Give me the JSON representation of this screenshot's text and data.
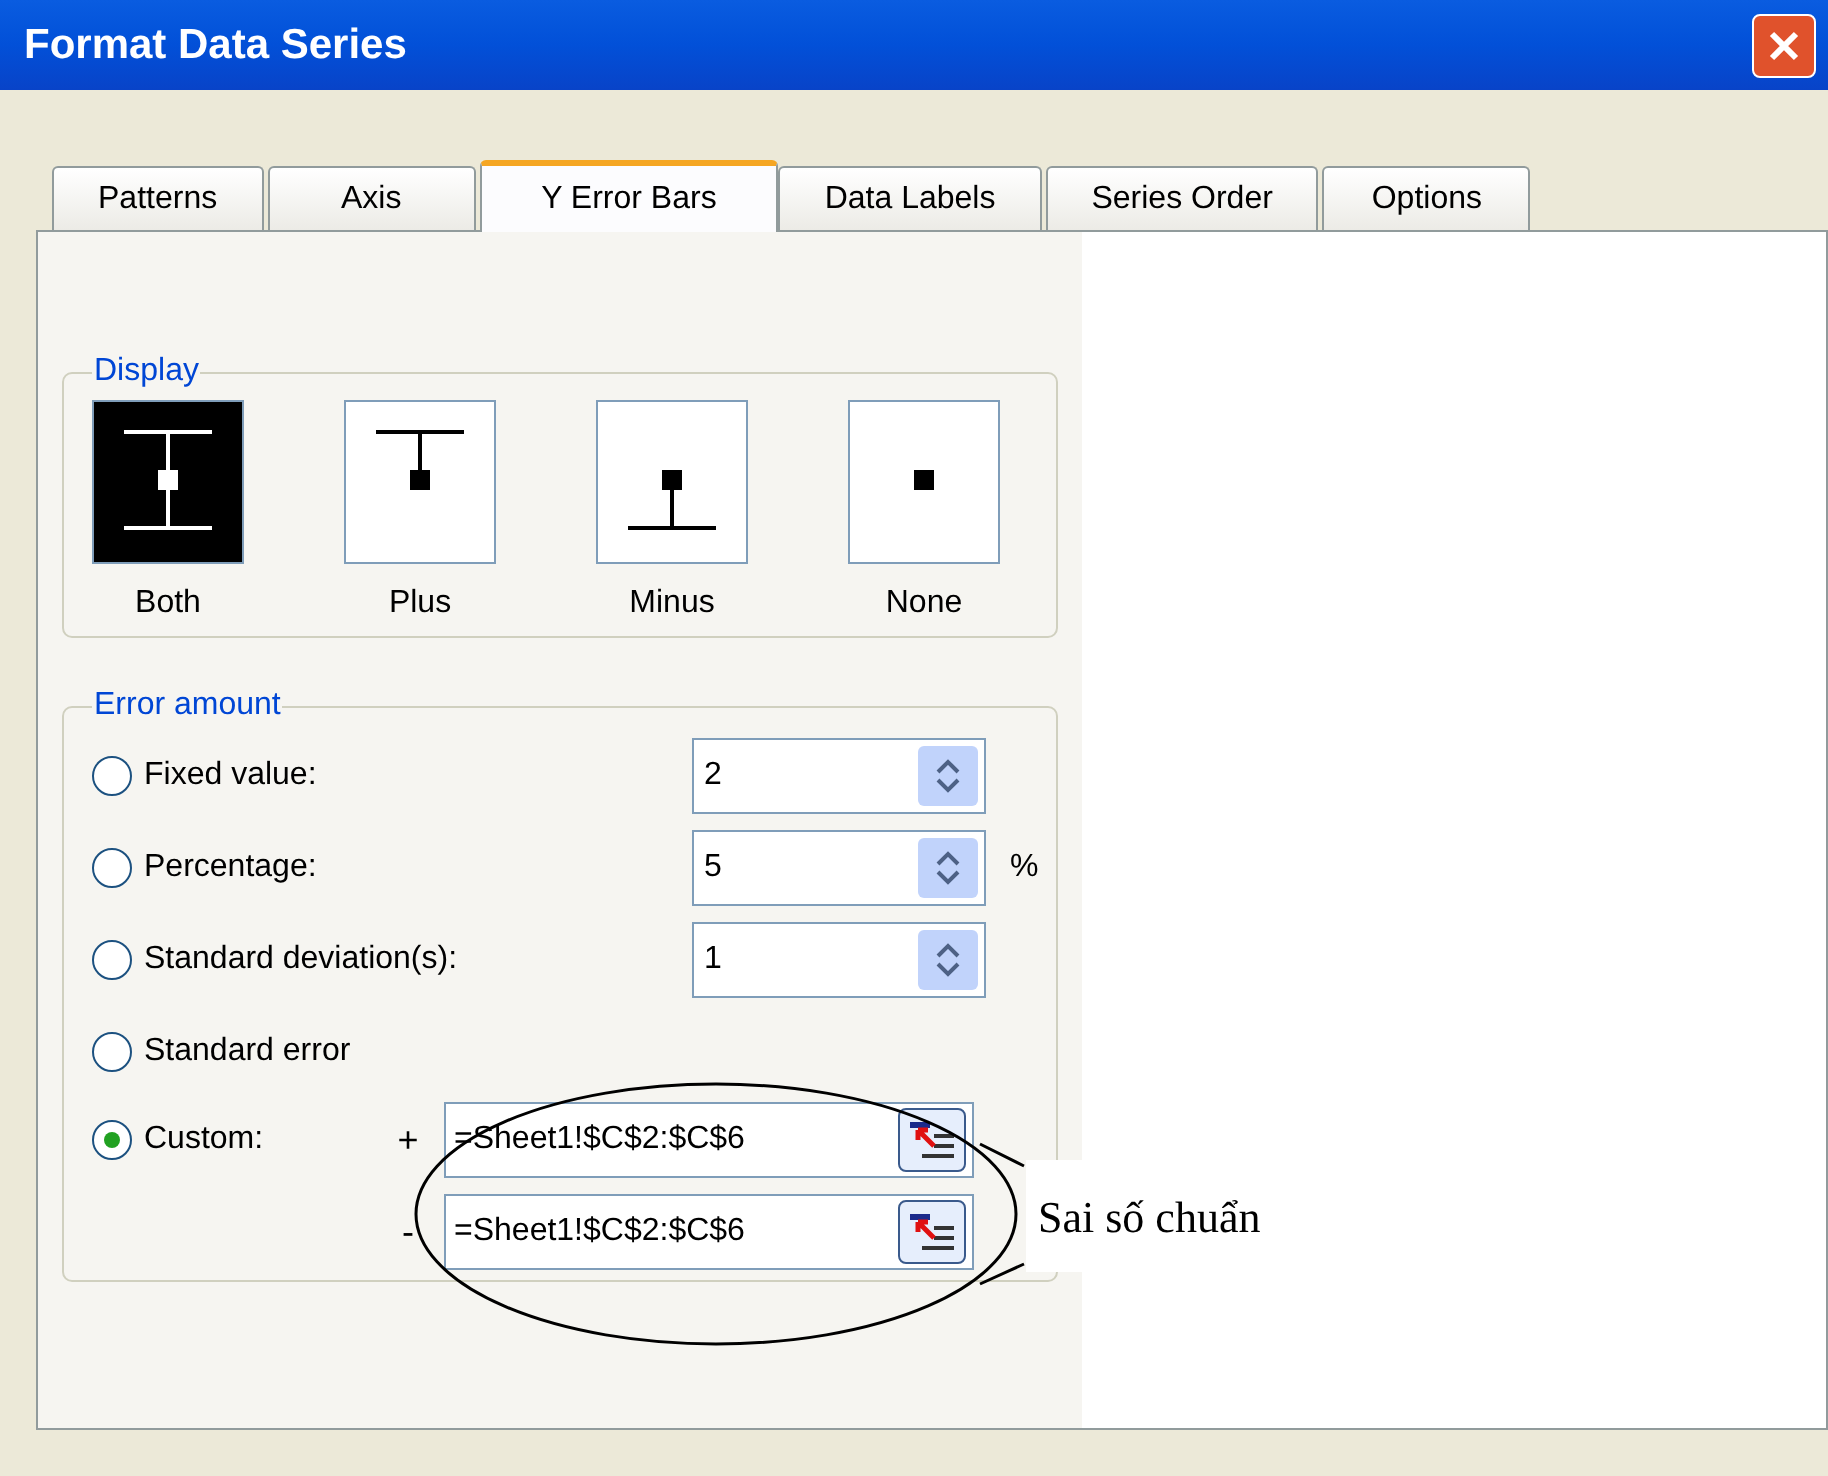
{
  "window": {
    "title": "Format Data Series"
  },
  "tabs": [
    {
      "label": "Patterns",
      "selected": false
    },
    {
      "label": "Axis",
      "selected": false
    },
    {
      "label": "Y Error Bars",
      "selected": true
    },
    {
      "label": "Data Labels",
      "selected": false
    },
    {
      "label": "Series Order",
      "selected": false
    },
    {
      "label": "Options",
      "selected": false
    }
  ],
  "display": {
    "label": "Display",
    "options": [
      {
        "label": "Both",
        "kind": "both",
        "selected": true
      },
      {
        "label": "Plus",
        "kind": "plus",
        "selected": false
      },
      {
        "label": "Minus",
        "kind": "minus",
        "selected": false
      },
      {
        "label": "None",
        "kind": "none",
        "selected": false
      }
    ]
  },
  "error_amount": {
    "label": "Error amount",
    "options": [
      {
        "kind": "spin",
        "label": "Fixed value:",
        "selected": false,
        "value": "2"
      },
      {
        "kind": "spin",
        "label": "Percentage:",
        "selected": false,
        "value": "5",
        "unit": "%"
      },
      {
        "kind": "spin",
        "label": "Standard deviation(s):",
        "selected": false,
        "value": "1"
      },
      {
        "kind": "plain",
        "label": "Standard error",
        "selected": false
      },
      {
        "kind": "custom",
        "label": "Custom:",
        "selected": true,
        "ranges": [
          {
            "sign": "+",
            "value": "=Sheet1!$C$2:$C$6"
          },
          {
            "sign": "-",
            "value": "=Sheet1!$C$2:$C$6"
          }
        ]
      }
    ]
  },
  "annotation": {
    "text": "Sai số chuẩn"
  }
}
